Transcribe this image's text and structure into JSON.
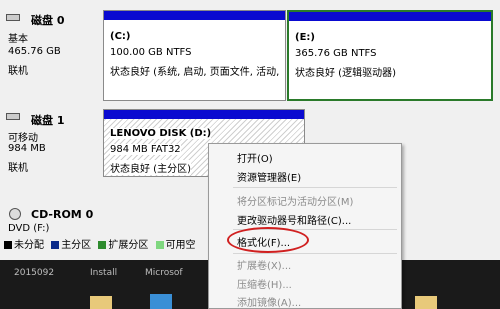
{
  "disks": [
    {
      "name": "磁盘 0",
      "type": "基本",
      "size": "465.76 GB",
      "status": "联机",
      "partitions": [
        {
          "letter": "(C:)",
          "size": "100.00 GB NTFS",
          "status": "状态良好 (系统, 启动, 页面文件, 活动,"
        },
        {
          "letter": "(E:)",
          "size": "365.76 GB NTFS",
          "status": "状态良好 (逻辑驱动器)"
        }
      ]
    },
    {
      "name": "磁盘 1",
      "type": "可移动",
      "size": "984 MB",
      "status": "联机",
      "partitions": [
        {
          "letter": "LENOVO DISK  (D:)",
          "size": "984 MB FAT32",
          "status": "状态良好 (主分区)"
        }
      ]
    },
    {
      "name": "CD-ROM 0",
      "type": "DVD (F:)"
    }
  ],
  "legend": [
    {
      "label": "未分配",
      "color": "#000000"
    },
    {
      "label": "主分区",
      "color": "#0a2a8a"
    },
    {
      "label": "扩展分区",
      "color": "#2e8b2e"
    },
    {
      "label": "可用空",
      "color": "#7fd77f"
    }
  ],
  "context_menu": {
    "items": [
      {
        "label": "打开(O)",
        "enabled": true
      },
      {
        "label": "资源管理器(E)",
        "enabled": true
      },
      {
        "label": "将分区标记为活动分区(M)",
        "enabled": false
      },
      {
        "label": "更改驱动器号和路径(C)...",
        "enabled": true
      },
      {
        "label": "格式化(F)...",
        "enabled": true,
        "highlighted": true
      },
      {
        "label": "扩展卷(X)...",
        "enabled": false
      },
      {
        "label": "压缩卷(H)...",
        "enabled": false
      },
      {
        "label": "添加镜像(A)...",
        "enabled": false
      }
    ]
  },
  "taskbar": {
    "items": [
      "2015092",
      "Install",
      "Microsof"
    ]
  },
  "colors": {
    "primary_bar": "#0a0ad0",
    "selected_border": "#2a7a2a",
    "highlight_circle": "#d02020"
  }
}
